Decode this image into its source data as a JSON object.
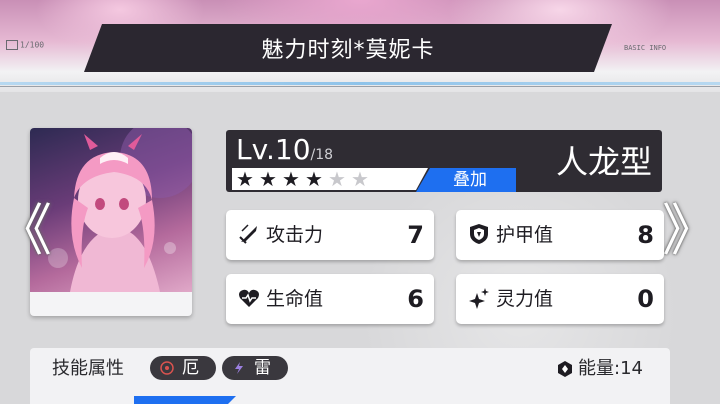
{
  "header": {
    "title": "魅力时刻*莫妮卡",
    "deco_left": "1/100",
    "deco_right": "BASIC INFO"
  },
  "character": {
    "level_prefix": "Lv.10",
    "level_max": "/18",
    "stars_total": 6,
    "stars_filled": 4,
    "stack_label": "叠加",
    "type": "人龙型"
  },
  "stats": [
    {
      "icon": "sword-icon",
      "label": "攻击力",
      "value": "7"
    },
    {
      "icon": "shield-icon",
      "label": "护甲值",
      "value": "8"
    },
    {
      "icon": "heart-icon",
      "label": "生命值",
      "value": "6"
    },
    {
      "icon": "sparkle-icon",
      "label": "灵力值",
      "value": "0"
    }
  ],
  "skills": {
    "label": "技能属性",
    "attributes": [
      {
        "icon": "curse-icon",
        "label": "厄",
        "icon_color": "#d9534f"
      },
      {
        "icon": "thunder-icon",
        "label": "雷",
        "icon_color": "#9b7fe0"
      }
    ],
    "energy_label": "能量:14"
  },
  "nav": {
    "prev": "《",
    "next": "》"
  },
  "colors": {
    "accent_blue": "#1e6ff0",
    "panel_dark": "#2f2c33"
  }
}
